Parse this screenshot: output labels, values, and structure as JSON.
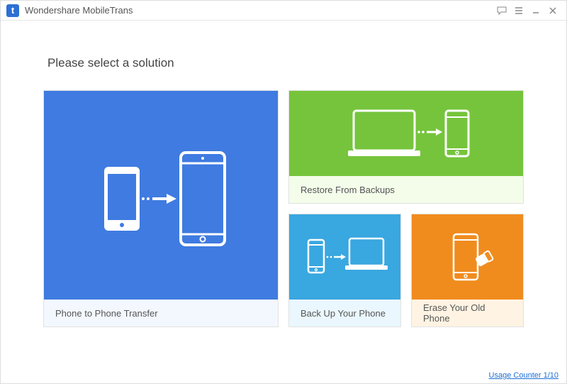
{
  "app": {
    "title": "Wondershare MobileTrans"
  },
  "heading": "Please select a solution",
  "cards": {
    "transfer": "Phone to Phone Transfer",
    "restore": "Restore From Backups",
    "backup": "Back Up Your Phone",
    "erase": "Erase Your Old Phone"
  },
  "footer": {
    "usage": "Usage Counter 1/10"
  },
  "colors": {
    "blue": "#3f7be0",
    "green": "#76c43c",
    "cyan": "#39a7e0",
    "orange": "#f08c1e"
  }
}
